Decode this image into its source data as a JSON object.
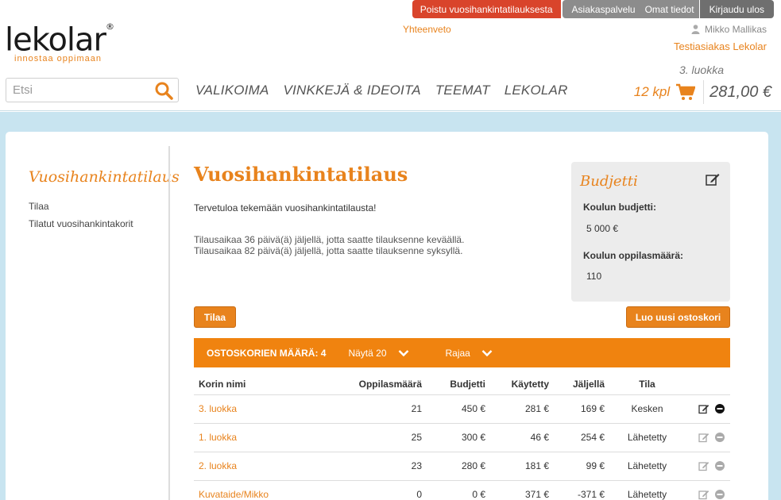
{
  "header": {
    "logo_text": "lekolar",
    "logo_reg": "®",
    "logo_tagline": "innostaa oppimaan",
    "topbar": {
      "exit_label": "Poistu vuosihankintatilauksesta",
      "customer_service": "Asiakaspalvelu",
      "my_info": "Omat tiedot",
      "logout": "Kirjaudu ulos"
    },
    "summary_link": "Yhteenveto",
    "user_name": "Mikko Mallikas",
    "customer_name": "Testiasiakas Lekolar",
    "search_placeholder": "Etsi",
    "nav": [
      "VALIKOIMA",
      "VINKKEJÄ & IDEOITA",
      "TEEMAT",
      "LEKOLAR"
    ],
    "cart": {
      "basket_name": "3. luokka",
      "count": "12 kpl",
      "total": "281,00 €"
    }
  },
  "sidebar": {
    "title": "Vuosihankintatilaus",
    "links": [
      "Tilaa",
      "Tilatut vuosihankintakorit"
    ]
  },
  "main": {
    "title": "Vuosihankintatilaus",
    "welcome": "Tervetuloa tekemään vuosihankintatilausta!",
    "notes": [
      "Tilausaikaa 36 päivä(ä) jäljellä, jotta saatte tilauksenne keväällä.",
      "Tilausaikaa 82 päivä(ä) jäljellä, jotta saatte tilauksenne syksyllä."
    ],
    "order_button": "Tilaa",
    "new_basket_button": "Luo uusi ostoskori"
  },
  "budget": {
    "title": "Budjetti",
    "school_budget_label": "Koulun budjetti:",
    "school_budget_value": "5 000  €",
    "students_label": "Koulun oppilasmäärä:",
    "students_value": "110"
  },
  "bar": {
    "count_label": "OSTOSKORIEN MÄÄRÄ: 4",
    "show_label": "Näytä 20",
    "filter_label": "Rajaa"
  },
  "table": {
    "headers": [
      "Korin nimi",
      "Oppilasmäärä",
      "Budjetti",
      "Käytetty",
      "Jäljellä",
      "Tila",
      ""
    ],
    "rows": [
      {
        "name": "3. luokka",
        "students": "21",
        "budget": "450 €",
        "used": "281 €",
        "left": "169 €",
        "status": "Kesken",
        "active": true
      },
      {
        "name": "1. luokka",
        "students": "25",
        "budget": "300 €",
        "used": "46 €",
        "left": "254 €",
        "status": "Lähetetty",
        "active": false
      },
      {
        "name": "2. luokka",
        "students": "23",
        "budget": "280 €",
        "used": "181 €",
        "left": "99 €",
        "status": "Lähetetty",
        "active": false
      },
      {
        "name": "Kuvataide/Mikko",
        "students": "0",
        "budget": "0 €",
        "used": "371 €",
        "left": "-371 €",
        "status": "Lähetetty",
        "active": false
      }
    ]
  },
  "colors": {
    "accent": "#e8831d",
    "bar": "#f0830f",
    "exit_button": "#d9442b",
    "topbar_grey": "#8c8c8c",
    "page_background": "#c8e4f0"
  }
}
